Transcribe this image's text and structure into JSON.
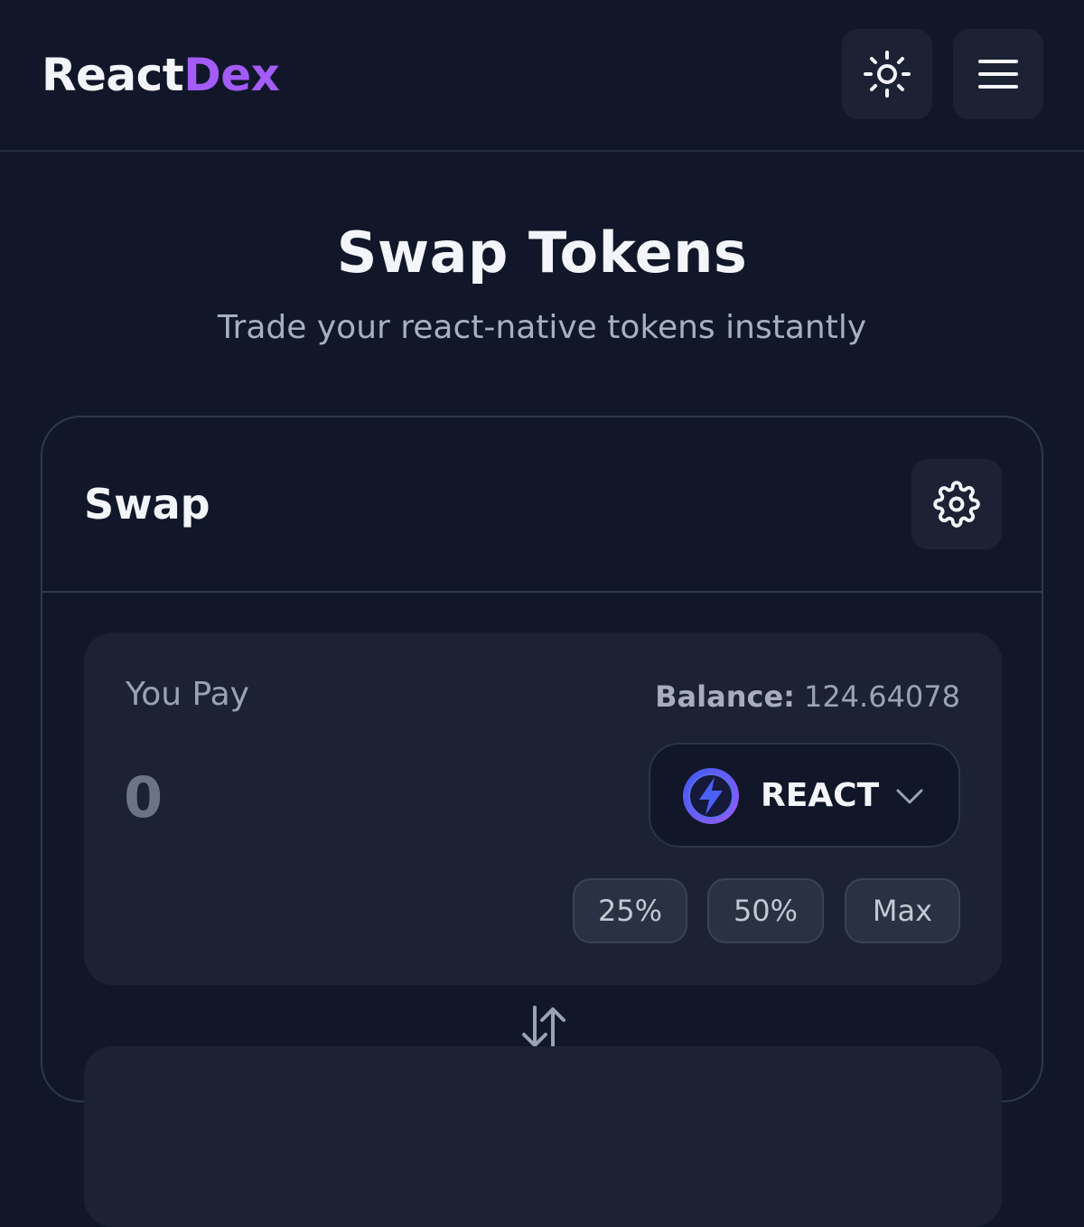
{
  "header": {
    "logo_part_a": "React",
    "logo_part_b": "Dex",
    "theme_icon": "sun-icon",
    "menu_icon": "hamburger-menu-icon"
  },
  "hero": {
    "title": "Swap Tokens",
    "subtitle": "Trade your react-native tokens instantly"
  },
  "swap_card": {
    "title": "Swap",
    "settings_icon": "gear-icon",
    "pay": {
      "label": "You Pay",
      "balance_label": "Balance:",
      "balance_value": "124.64078",
      "amount_placeholder": "0",
      "token_symbol": "REACT",
      "token_icon": "lightning-bolt-icon",
      "percent_buttons": [
        "25%",
        "50%",
        "Max"
      ]
    },
    "swap_direction_icon": "swap-arrows-icon"
  },
  "colors": {
    "background": "#111729",
    "panel": "#1c2234",
    "accent": "#a35cf6",
    "token_gradient_start": "#3b5cf5",
    "token_gradient_end": "#9a5cf6"
  }
}
